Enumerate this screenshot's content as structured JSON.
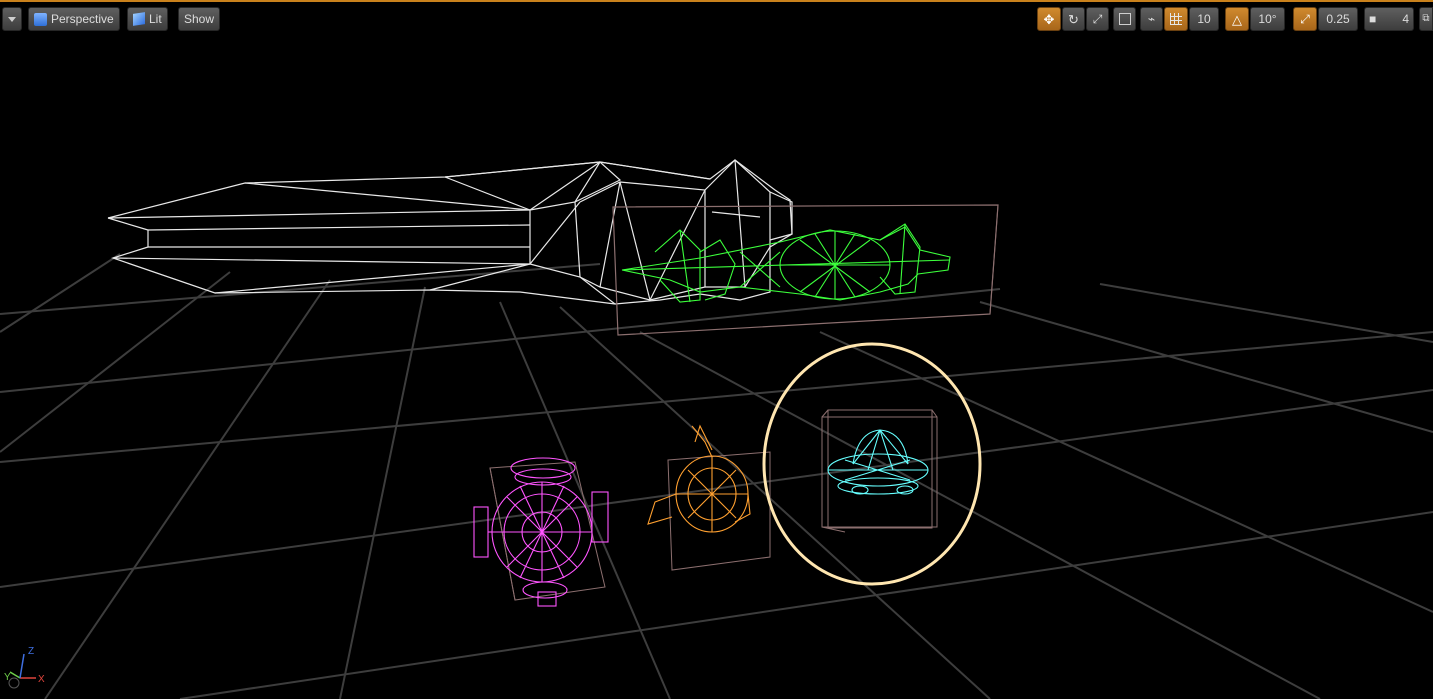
{
  "toolbar": {
    "perspective_label": "Perspective",
    "lit_label": "Lit",
    "show_label": "Show",
    "grid_snap_value": "10",
    "rotation_snap_value": "10°",
    "scale_snap_value": "0.25",
    "camera_speed_value": "4"
  },
  "axis": {
    "x_label": "X",
    "y_label": "Y",
    "z_label": "Z"
  },
  "colors": {
    "accent": "#d08a2e",
    "ship_white": "#e8e8e8",
    "ship_green": "#3cff3c",
    "model_magenta": "#ff55ff",
    "model_orange": "#ffa030",
    "model_cyan": "#66ffff",
    "selection_ring": "#ffe6b0",
    "bounds": "#8c6f6f"
  },
  "icons": [
    "dropdown-arrow-icon",
    "perspective-icon",
    "lit-icon",
    "translate-icon",
    "rotate-icon",
    "scale-icon",
    "coordinate-space-icon",
    "surface-snap-icon",
    "grid-snap-icon",
    "rotation-snap-icon",
    "scale-snap-icon",
    "camera-speed-icon",
    "maximize-icon"
  ]
}
